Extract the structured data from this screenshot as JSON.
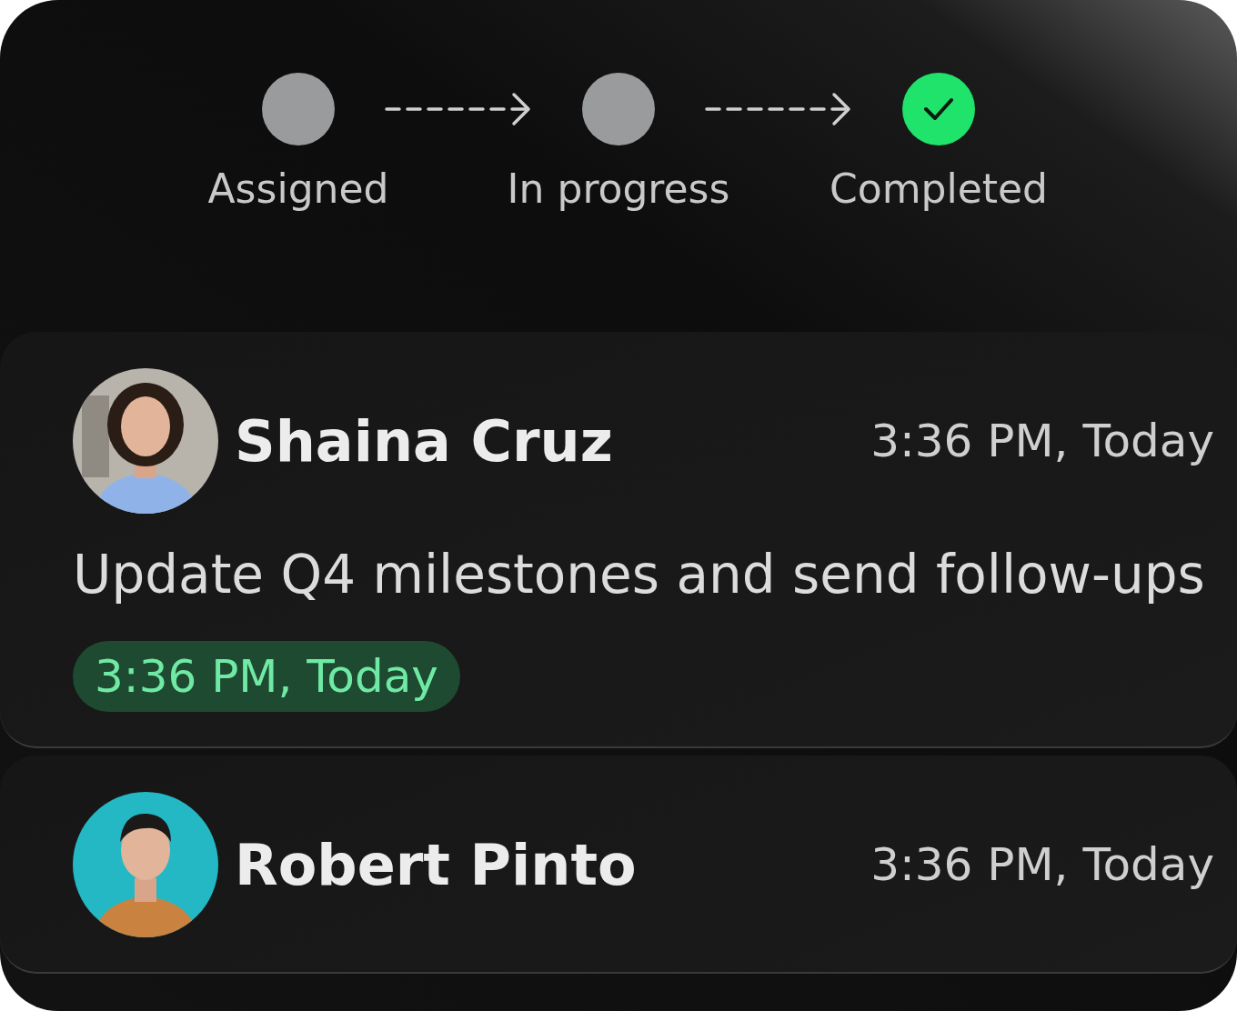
{
  "steps": [
    {
      "label": "Assigned",
      "completed": false
    },
    {
      "label": "In progress",
      "completed": false
    },
    {
      "label": "Completed",
      "completed": true
    }
  ],
  "tasks": [
    {
      "name": "Shaina Cruz",
      "time": "3:36 PM, Today",
      "title": "Update Q4 milestones and send follow-ups",
      "badge": "3:36 PM, Today"
    },
    {
      "name": "Robert Pinto",
      "time": "3:36 PM, Today"
    }
  ]
}
